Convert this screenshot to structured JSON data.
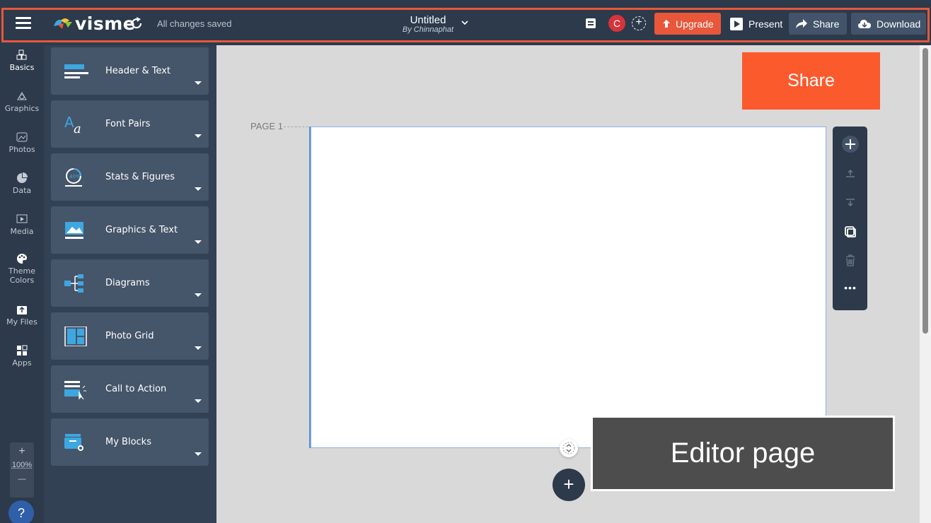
{
  "header": {
    "logo_text": "visme",
    "save_status": "All changes saved",
    "doc_title": "Untitled",
    "doc_author": "By Chinnaphat",
    "avatar_initial": "C",
    "upgrade_label": "Upgrade",
    "present_label": "Present",
    "share_label": "Share",
    "download_label": "Download"
  },
  "rail": {
    "items": [
      {
        "label": "Basics",
        "icon": "blocks-icon"
      },
      {
        "label": "Graphics",
        "icon": "graphics-icon"
      },
      {
        "label": "Photos",
        "icon": "photo-icon"
      },
      {
        "label": "Data",
        "icon": "pie-chart-icon"
      },
      {
        "label": "Media",
        "icon": "media-icon"
      },
      {
        "label": "Theme",
        "label2": "Colors",
        "icon": "palette-icon"
      },
      {
        "label": "My Files",
        "icon": "upload-folder-icon"
      },
      {
        "label": "Apps",
        "icon": "apps-grid-icon"
      }
    ],
    "zoom_plus": "+",
    "zoom_level": "100%",
    "zoom_minus": "—",
    "help": "?"
  },
  "panel": {
    "blocks": [
      {
        "label": "Header & Text"
      },
      {
        "label": "Font Pairs"
      },
      {
        "label": "Stats & Figures"
      },
      {
        "label": "Graphics & Text"
      },
      {
        "label": "Diagrams"
      },
      {
        "label": "Photo Grid"
      },
      {
        "label": "Call to Action"
      },
      {
        "label": "My Blocks"
      }
    ]
  },
  "canvas": {
    "page_label": "PAGE 1",
    "stat_thumb_text": "40%",
    "toolbar_more": "•••"
  },
  "callouts": {
    "share": "Share",
    "editor": "Editor page"
  },
  "colors": {
    "topbar_bg": "#2c3a4b",
    "accent": "#e8573a",
    "panel_bg": "#324154",
    "block_bg": "#45556a",
    "block_icon": "#3ea7e0"
  }
}
